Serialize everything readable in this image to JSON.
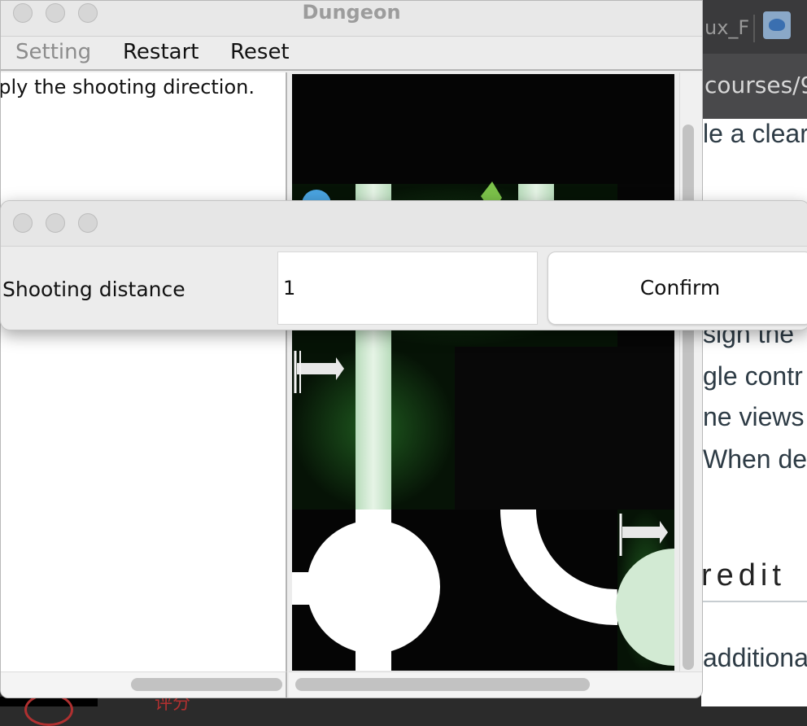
{
  "window": {
    "title": "Dungeon",
    "menu": {
      "setting_label": "Setting",
      "restart_label": "Restart",
      "reset_label": "Reset"
    },
    "status_text": "nply the shooting direction."
  },
  "dialog": {
    "label": "Shooting distance",
    "input_value": "1",
    "confirm_label": "Confirm"
  },
  "background_browser": {
    "tab_text": "ux_F",
    "favicon": "bird-icon",
    "url_text": "courses/9",
    "page_lines": [
      "le a clear",
      "sign the",
      "gle contr",
      "ne views",
      "When de"
    ],
    "heading": "redit",
    "last_line": "additiona",
    "bottom_text": "评分"
  },
  "colors": {
    "map_background": "#060606",
    "tunnel_green": "#cfe9d0",
    "window_chrome": "#ececec"
  }
}
